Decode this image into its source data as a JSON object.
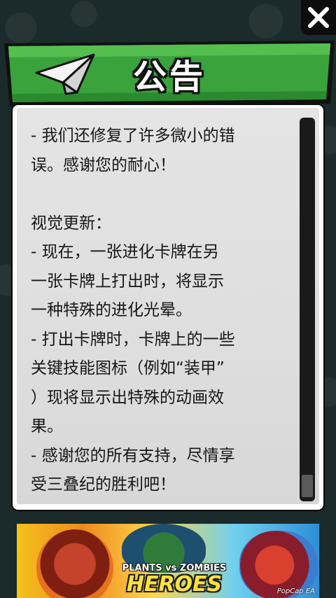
{
  "header": {
    "title": "公告"
  },
  "notice": {
    "text": "- 我们还修复了许多微小的错\n误。感谢您的耐心！\n\n视觉更新：\n- 现在，一张进化卡牌在另\n一张卡牌上打出时，将显示\n一种特殊的进化光晕。\n- 打出卡牌时，卡牌上的一些\n关键技能图标（例如“装甲”\n）现将显示出特殊的动画效\n果。\n- 感谢您的所有支持，尽情享\n受三叠纪的胜利吧！",
    "scroll_position": 0.95
  },
  "icons": {
    "close": "close-icon",
    "header": "paper-plane-icon"
  },
  "ad": {
    "logo_line1": "PLANTS vs ZOMBIES",
    "logo_line2": "HEROES",
    "publisher": "PopCap EA"
  },
  "colors": {
    "ribbon_green": "#3aa33c",
    "ribbon_dark": "#237426",
    "panel_bg": "#e0e0e0",
    "text": "#161616"
  }
}
